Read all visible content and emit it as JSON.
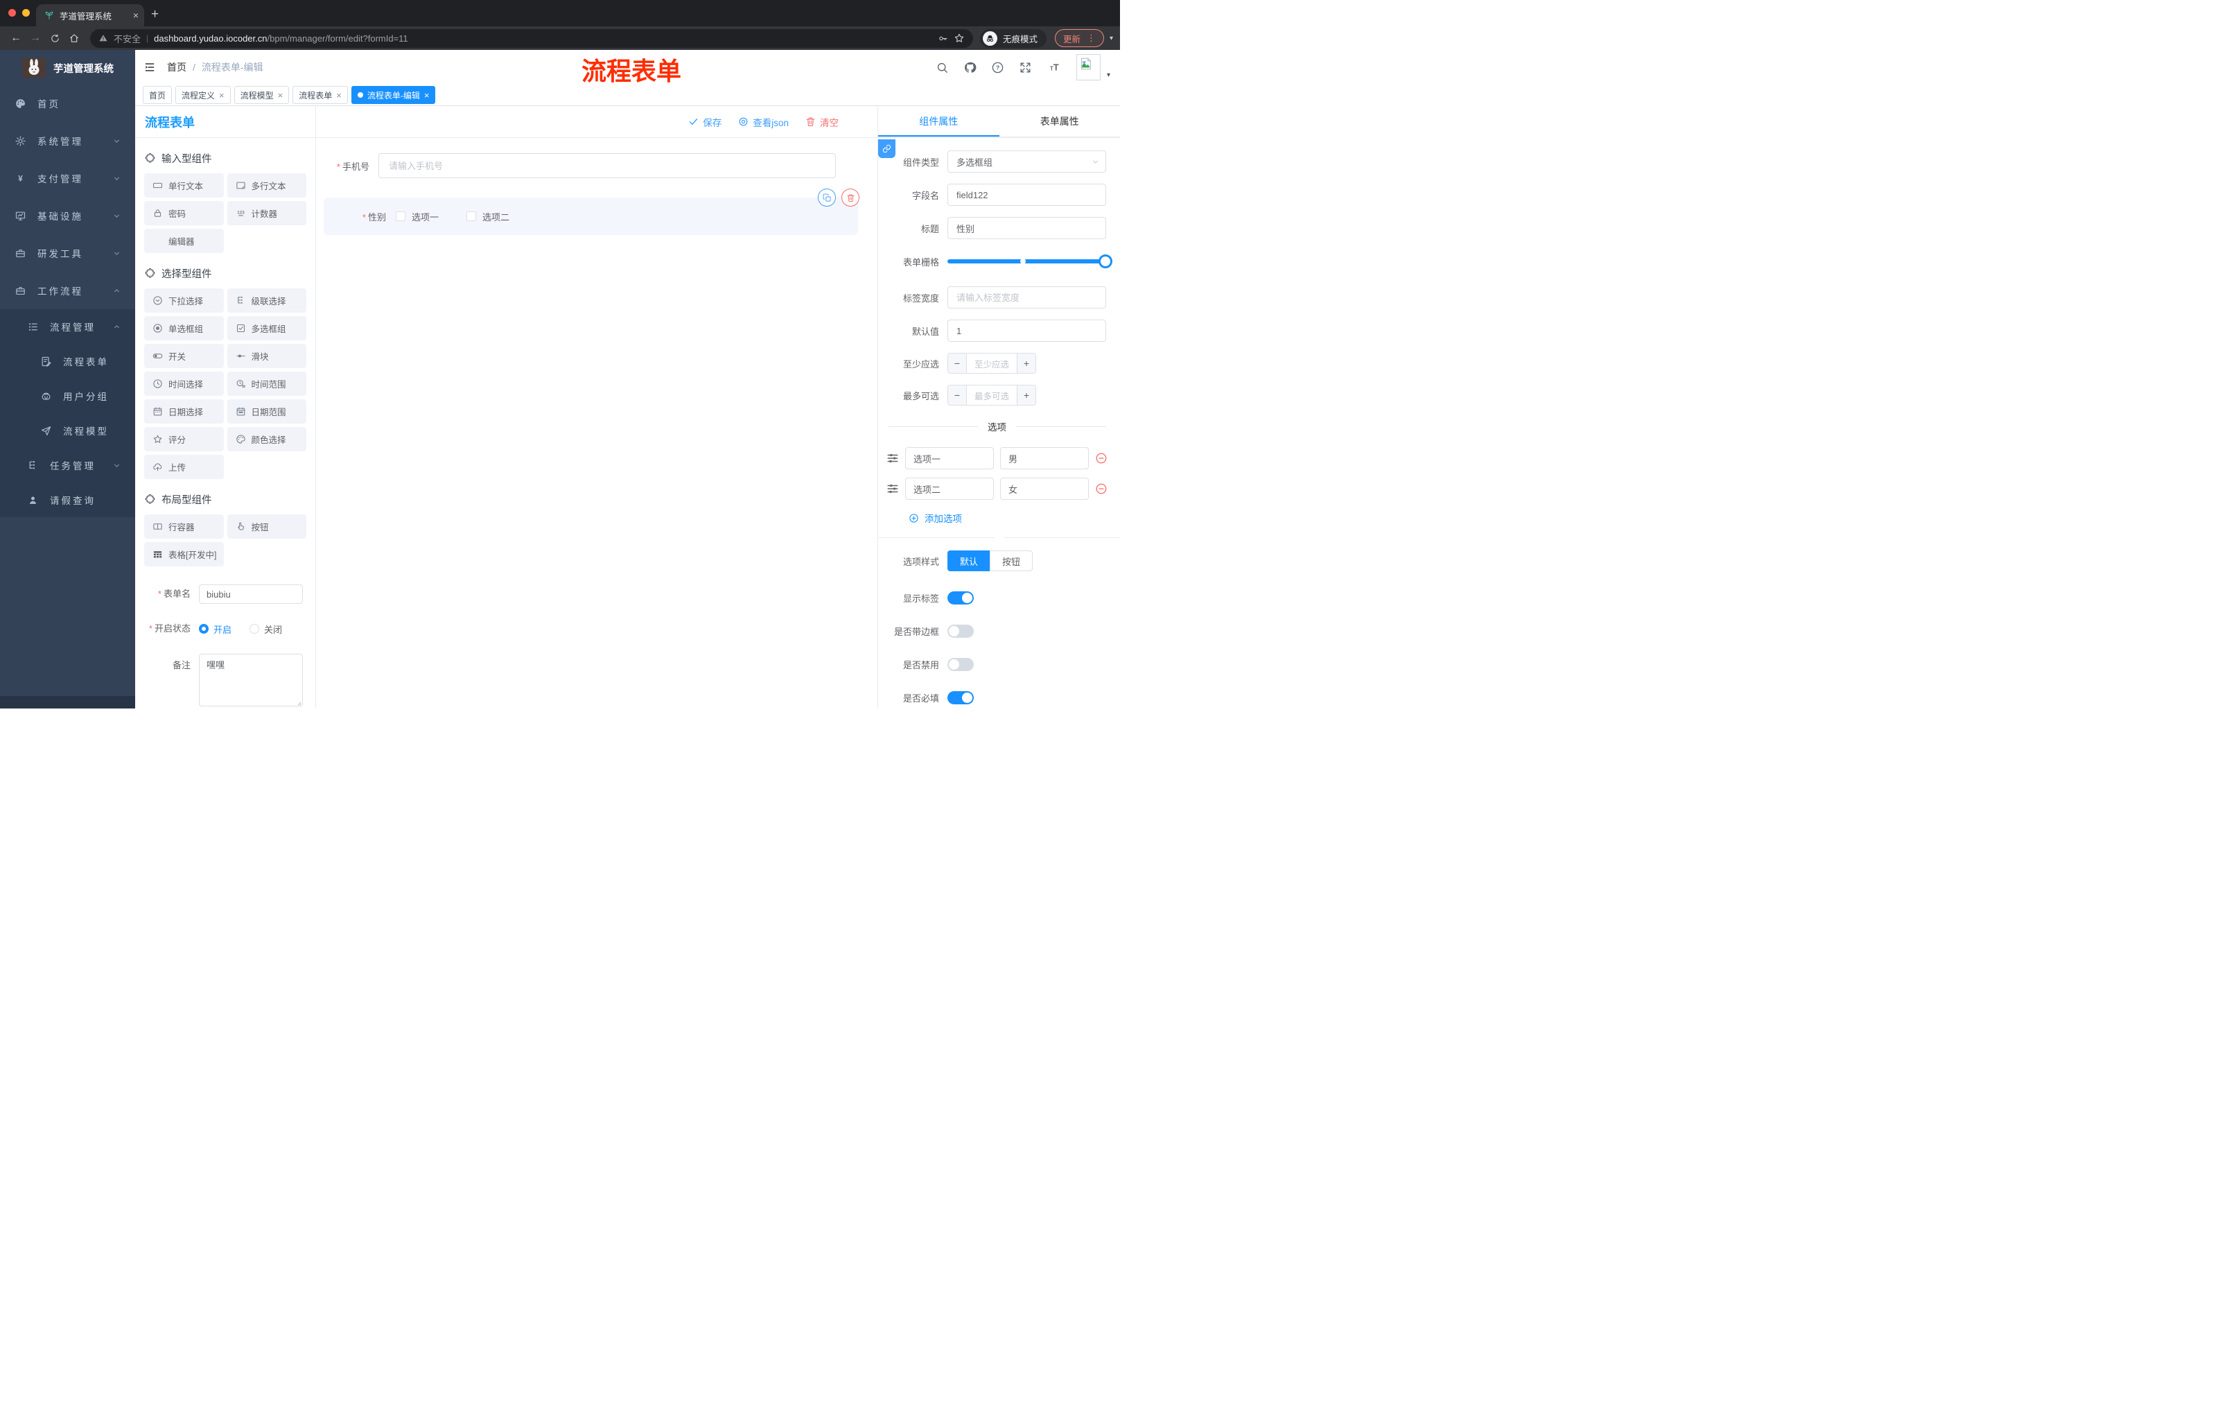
{
  "icons": {
    "close": "×",
    "plus": "+",
    "minus": "−",
    "more": "⋮",
    "caret": "▾",
    "pipe": "|",
    "slash": "/",
    "asterisk": "*",
    "back": "←",
    "forward": "→"
  },
  "browser": {
    "tab_title": "芋道管理系统",
    "security": "不安全",
    "url_domain": "dashboard.yudao.iocoder.cn",
    "url_path": "/bpm/manager/form/edit?formId=11",
    "incognito": "无痕模式",
    "update": "更新"
  },
  "annotation": {
    "text": "流程表单"
  },
  "sidebar": {
    "title": "芋道管理系统",
    "items": [
      {
        "label": "首页"
      },
      {
        "label": "系统管理"
      },
      {
        "label": "支付管理"
      },
      {
        "label": "基础设施"
      },
      {
        "label": "研发工具"
      },
      {
        "label": "工作流程"
      },
      {
        "label": "流程管理"
      },
      {
        "label": "流程表单"
      },
      {
        "label": "用户分组"
      },
      {
        "label": "流程模型"
      },
      {
        "label": "任务管理"
      },
      {
        "label": "请假查询"
      }
    ]
  },
  "header": {
    "breadcrumb": [
      "首页",
      "流程表单-编辑"
    ]
  },
  "tags": [
    {
      "label": "首页"
    },
    {
      "label": "流程定义"
    },
    {
      "label": "流程模型"
    },
    {
      "label": "流程表单"
    },
    {
      "label": "流程表单-编辑"
    }
  ],
  "builder": {
    "title": "流程表单",
    "actions": {
      "save": "保存",
      "view_json": "查看json",
      "clear": "清空"
    },
    "groups": [
      {
        "title": "输入型组件",
        "items": [
          "单行文本",
          "多行文本",
          "密码",
          "计数器",
          "编辑器"
        ]
      },
      {
        "title": "选择型组件",
        "items": [
          "下拉选择",
          "级联选择",
          "单选框组",
          "多选框组",
          "开关",
          "滑块",
          "时间选择",
          "时间范围",
          "日期选择",
          "日期范围",
          "评分",
          "颜色选择",
          "上传"
        ]
      },
      {
        "title": "布局型组件",
        "items": [
          "行容器",
          "按钮",
          "表格[开发中]"
        ]
      }
    ],
    "form": {
      "name_label": "表单名",
      "name_value": "biubiu",
      "status_label": "开启状态",
      "status_on": "开启",
      "status_off": "关闭",
      "remark_label": "备注",
      "remark_value": "嘿嘿"
    }
  },
  "canvas": {
    "phone_label": "手机号",
    "phone_placeholder": "请输入手机号",
    "gender_label": "性别",
    "gender_options": [
      "选项一",
      "选项二"
    ]
  },
  "inspector": {
    "tab_component": "组件属性",
    "tab_form": "表单属性",
    "component_type_label": "组件类型",
    "component_type_value": "多选框组",
    "field_label": "字段名",
    "field_value": "field122",
    "title_label": "标题",
    "title_value": "性别",
    "grid_label": "表单栅格",
    "label_width_label": "标签宽度",
    "label_width_placeholder": "请输入标签宽度",
    "default_label": "默认值",
    "default_value": "1",
    "min_label": "至少应选",
    "min_placeholder": "至少应选",
    "max_label": "最多可选",
    "max_placeholder": "最多可选",
    "options_title": "选项",
    "options": [
      {
        "name": "选项一",
        "value": "男"
      },
      {
        "name": "选项二",
        "value": "女"
      }
    ],
    "add_option": "添加选项",
    "style_label": "选项样式",
    "style_default": "默认",
    "style_button": "按钮",
    "toggle_show_label": "显示标签",
    "toggle_border": "是否带边框",
    "toggle_disabled": "是否禁用",
    "toggle_required": "是否必填"
  },
  "colors": {
    "accent": "#1890ff",
    "link": "#409eff",
    "danger": "#f56c6c",
    "annotation_red": "#ff2d00",
    "sidebar_bg": "#344258"
  }
}
